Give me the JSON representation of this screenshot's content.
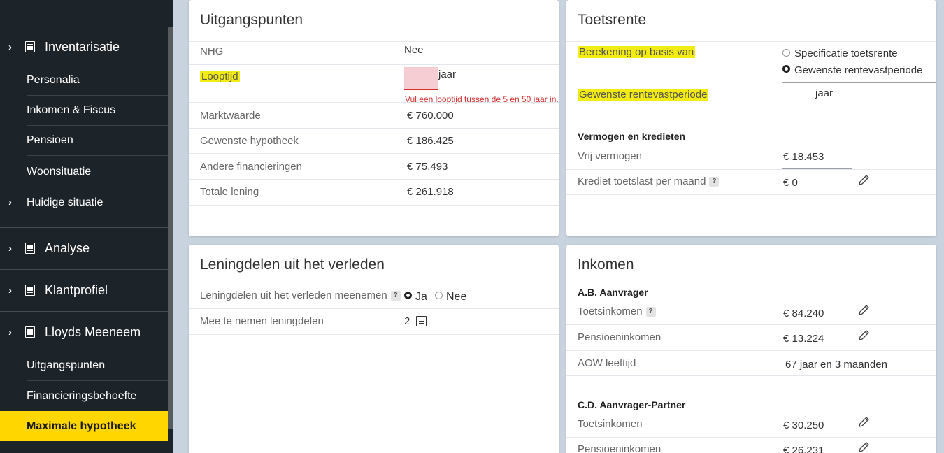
{
  "sidebar": {
    "sections": [
      {
        "label": "Inventarisatie",
        "items": [
          "Personalia",
          "Inkomen & Fiscus",
          "Pensioen",
          "Woonsituatie"
        ],
        "chevron_item": "Huidige situatie"
      },
      {
        "label": "Analyse"
      },
      {
        "label": "Klantprofiel"
      },
      {
        "label": "Lloyds Meeneem",
        "items": [
          "Uitgangspunten",
          "Financieringsbehoefte"
        ],
        "active_item": "Maximale hypotheek"
      }
    ],
    "active_color": "#ffd600"
  },
  "uitgangspunten": {
    "title": "Uitgangspunten",
    "nhg_label": "NHG",
    "nhg_value": "Nee",
    "looptijd_label": "Looptijd",
    "looptijd_unit": "jaar",
    "looptijd_error": "Vul een looptijd tussen de 5 en 50 jaar in.",
    "rows": [
      {
        "label": "Marktwaarde",
        "value": "€ 760.000"
      },
      {
        "label": "Gewenste hypotheek",
        "value": "€ 186.425"
      },
      {
        "label": "Andere financieringen",
        "value": "€ 75.493"
      },
      {
        "label": "Totale lening",
        "value": "€ 261.918"
      }
    ]
  },
  "toetsrente": {
    "title": "Toetsrente",
    "berekening_label": "Berekening op basis van",
    "options": [
      "Specificatie toetsrente",
      "Gewenste rentevastperiode"
    ],
    "selected_option": "Gewenste rentevastperiode",
    "rentevast_label": "Gewenste rentevastperiode",
    "rentevast_unit": "jaar",
    "vermogen_header": "Vermogen en kredieten",
    "vrij_vermogen_label": "Vrij vermogen",
    "vrij_vermogen_value": "€ 18.453",
    "krediet_label": "Krediet toetslast per maand",
    "krediet_value": "€ 0"
  },
  "leningdelen": {
    "title": "Leningdelen uit het verleden",
    "meenemen_label": "Leningdelen uit het verleden meenemen",
    "ja_label": "Ja",
    "nee_label": "Nee",
    "selected": "Ja",
    "mee_label": "Mee te nemen leningdelen",
    "mee_value": "2"
  },
  "inkomen": {
    "title": "Inkomen",
    "aanvrager": {
      "name": "A.B. Aanvrager",
      "toets_label": "Toetsinkomen",
      "toets_value": "€ 84.240",
      "pensioen_label": "Pensioeninkomen",
      "pensioen_value": "€ 13.224",
      "aow_label": "AOW leeftijd",
      "aow_value": "67 jaar en 3 maanden"
    },
    "partner": {
      "name": "C.D. Aanvrager-Partner",
      "toets_label": "Toetsinkomen",
      "toets_value": "€ 30.250",
      "pensioen_label": "Pensioeninkomen",
      "pensioen_value": "€ 26.231"
    }
  },
  "colors": {
    "highlight": "#f3ec13",
    "error": "#d32f2f",
    "sidebar_bg": "#1c2329"
  }
}
